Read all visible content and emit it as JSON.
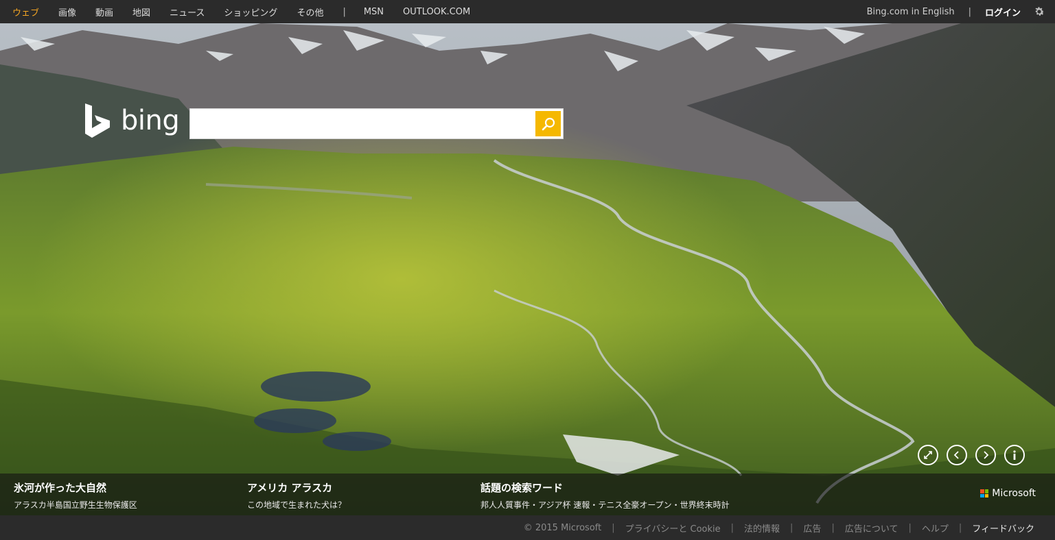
{
  "nav": {
    "items": [
      {
        "label": "ウェブ",
        "active": true
      },
      {
        "label": "画像"
      },
      {
        "label": "動画"
      },
      {
        "label": "地図"
      },
      {
        "label": "ニュース"
      },
      {
        "label": "ショッピング"
      },
      {
        "label": "その他"
      }
    ],
    "separator": "|",
    "msn": "MSN",
    "outlook": "OUTLOOK.COM",
    "english": "Bing.com in English",
    "login": "ログイン",
    "settings_icon": "gear-icon"
  },
  "brand": {
    "logo_text": "bing",
    "accent": "#f5a623",
    "search_button_color": "#f5b800"
  },
  "search": {
    "value": "",
    "placeholder": ""
  },
  "info": {
    "items": [
      {
        "title": "氷河が作った大自然",
        "sub": "アラスカ半島国立野生生物保護区"
      },
      {
        "title": "アメリカ アラスカ",
        "sub": "この地域で生まれた犬は？"
      },
      {
        "title": "話題の検索ワード",
        "sub": "邦人人質事件・アジア杯 速報・テニス全豪オープン・世界終末時計"
      }
    ],
    "microsoft": "Microsoft"
  },
  "footer": {
    "copyright": "© 2015 Microsoft",
    "links": [
      "プライバシーと Cookie",
      "法的情報",
      "広告",
      "広告について",
      "ヘルプ"
    ],
    "feedback": "フィードバック",
    "separator": "|"
  }
}
